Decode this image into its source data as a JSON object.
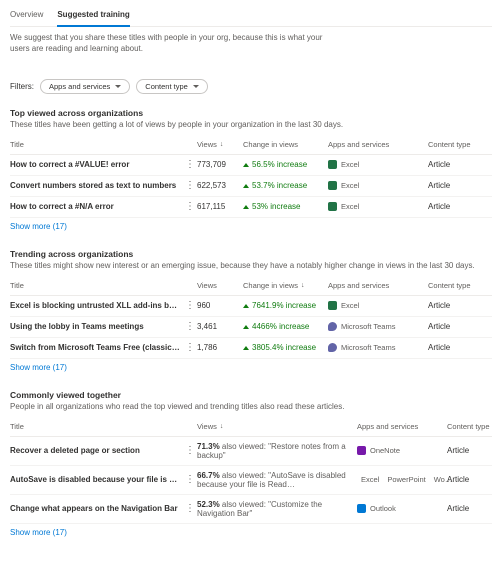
{
  "tabs": {
    "overview": "Overview",
    "suggested": "Suggested training"
  },
  "description": "We suggest that you share these titles with people in your org, because this is what your users are reading and learning about.",
  "filters": {
    "label": "Filters:",
    "apps": "Apps and services",
    "content": "Content type"
  },
  "columns": {
    "title": "Title",
    "views": "Views",
    "change": "Change in views",
    "apps": "Apps and services",
    "ctype": "Content type"
  },
  "top": {
    "heading": "Top viewed across organizations",
    "sub": "These titles have been getting a lot of views by people in your organization in the last 30 days.",
    "rows": [
      {
        "title": "How to correct a #VALUE! error",
        "views": "773,709",
        "change": "56.5% increase",
        "app": "Excel",
        "ctype": "Article"
      },
      {
        "title": "Convert numbers stored as text to numbers",
        "views": "622,573",
        "change": "53.7% increase",
        "app": "Excel",
        "ctype": "Article"
      },
      {
        "title": "How to correct a #N/A error",
        "views": "617,115",
        "change": "53% increase",
        "app": "Excel",
        "ctype": "Article"
      }
    ],
    "more": "Show more (17)"
  },
  "trending": {
    "heading": "Trending across organizations",
    "sub": "These titles might show new interest or an emerging issue, because they have a notably higher change in views in the last 30 days.",
    "rows": [
      {
        "title": "Excel is blocking untrusted XLL add-ins by default",
        "views": "960",
        "change": "7641.9% increase",
        "app": "Excel",
        "ctype": "Article"
      },
      {
        "title": "Using the lobby in Teams meetings",
        "views": "3,461",
        "change": "4466% increase",
        "app": "Microsoft Teams",
        "ctype": "Article"
      },
      {
        "title": "Switch from Microsoft Teams Free (classic) to Microsoft …",
        "views": "1,786",
        "change": "3805.4% increase",
        "app": "Microsoft Teams",
        "ctype": "Article"
      }
    ],
    "more": "Show more (17)"
  },
  "common": {
    "heading": "Commonly viewed together",
    "sub": "People in all organizations who read the top viewed and trending titles also read these articles.",
    "rows": [
      {
        "title": "Recover a deleted page or section",
        "pct": "71.3%",
        "also": "also viewed: \"Restore notes from a backup\"",
        "apps": [
          "OneNote"
        ],
        "ctype": "Article"
      },
      {
        "title": "AutoSave is disabled because your file is not stored on th…",
        "pct": "66.7%",
        "also": "also viewed: \"AutoSave is disabled because your file is Read…",
        "apps": [
          "Excel",
          "PowerPoint",
          "Wo…"
        ],
        "ctype": "Article"
      },
      {
        "title": "Change what appears on the Navigation Bar",
        "pct": "52.3%",
        "also": "also viewed: \"Customize the Navigation Bar\"",
        "apps": [
          "Outlook"
        ],
        "ctype": "Article"
      }
    ],
    "more": "Show more (17)"
  },
  "appIconClass": {
    "Excel": "i-excel",
    "Microsoft Teams": "i-teams",
    "OneNote": "i-onenote",
    "PowerPoint": "i-ppt",
    "Wo…": "i-word",
    "Outlook": "i-outlook"
  }
}
